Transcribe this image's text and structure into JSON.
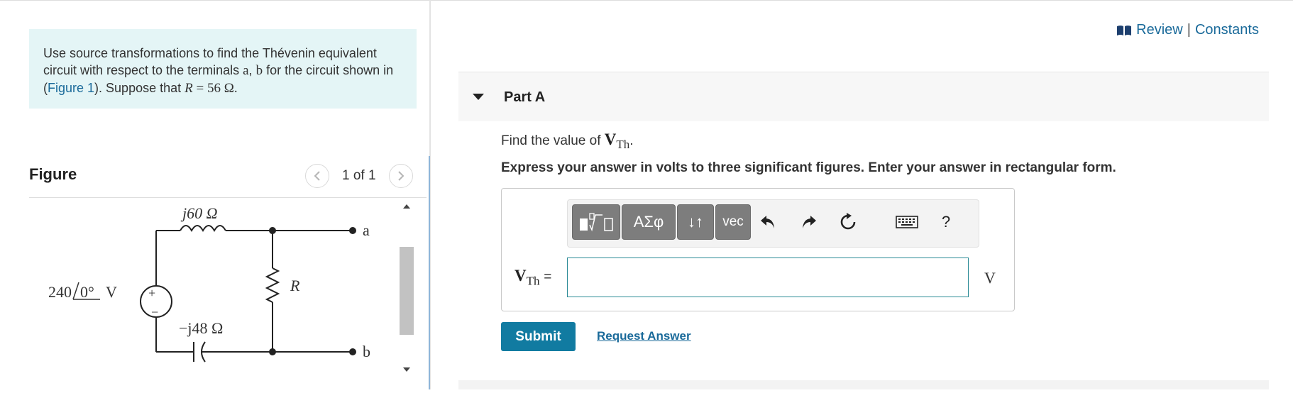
{
  "problem": {
    "text_before": "Use source transformations to find the Thévenin equivalent circuit with respect to the terminals ",
    "terminal_a": "a",
    "comma": ", ",
    "terminal_b": "b",
    "text_mid": " for the circuit shown in (",
    "figure_link": "Figure 1",
    "text_after": "). Suppose that ",
    "r_symbol": "R",
    "r_value": " = 56 Ω."
  },
  "figure": {
    "title": "Figure",
    "pager": "1 of 1",
    "prev_icon": "chevron-left",
    "next_icon": "chevron-right",
    "circuit": {
      "inductor_label": "j60 Ω",
      "capacitor_label": "−j48 Ω",
      "source_magnitude": "240",
      "source_angle": "0°",
      "source_unit": "V",
      "source_plus": "+",
      "source_minus": "−",
      "resistor_label": "R",
      "terminal_a": "a",
      "terminal_b": "b"
    }
  },
  "header": {
    "review": "Review",
    "separator": "|",
    "constants": "Constants",
    "review_icon": "book"
  },
  "part": {
    "title": "Part A",
    "question_prefix": "Find the value of ",
    "symbol_v": "V",
    "symbol_sub": "Th",
    "question_suffix": ".",
    "instruction": "Express your answer in volts to three significant figures. Enter your answer in rectangular form."
  },
  "toolbar": {
    "templates_icon": "templates-icon",
    "greek": "ΑΣφ",
    "arrows": "↓↑",
    "vec": "vec",
    "help": "?",
    "undo_icon": "undo",
    "redo_icon": "redo",
    "reset_icon": "reset",
    "keyboard_icon": "keyboard"
  },
  "answer": {
    "label_v": "V",
    "label_sub": "Th",
    "equals": "=",
    "value": "",
    "unit": "V"
  },
  "actions": {
    "submit": "Submit",
    "request_answer": "Request Answer"
  },
  "colors": {
    "accent": "#117ba1",
    "link": "#1a6a9a",
    "problem_bg": "#e4f5f6",
    "toolbar_button": "#7d7d7d"
  }
}
